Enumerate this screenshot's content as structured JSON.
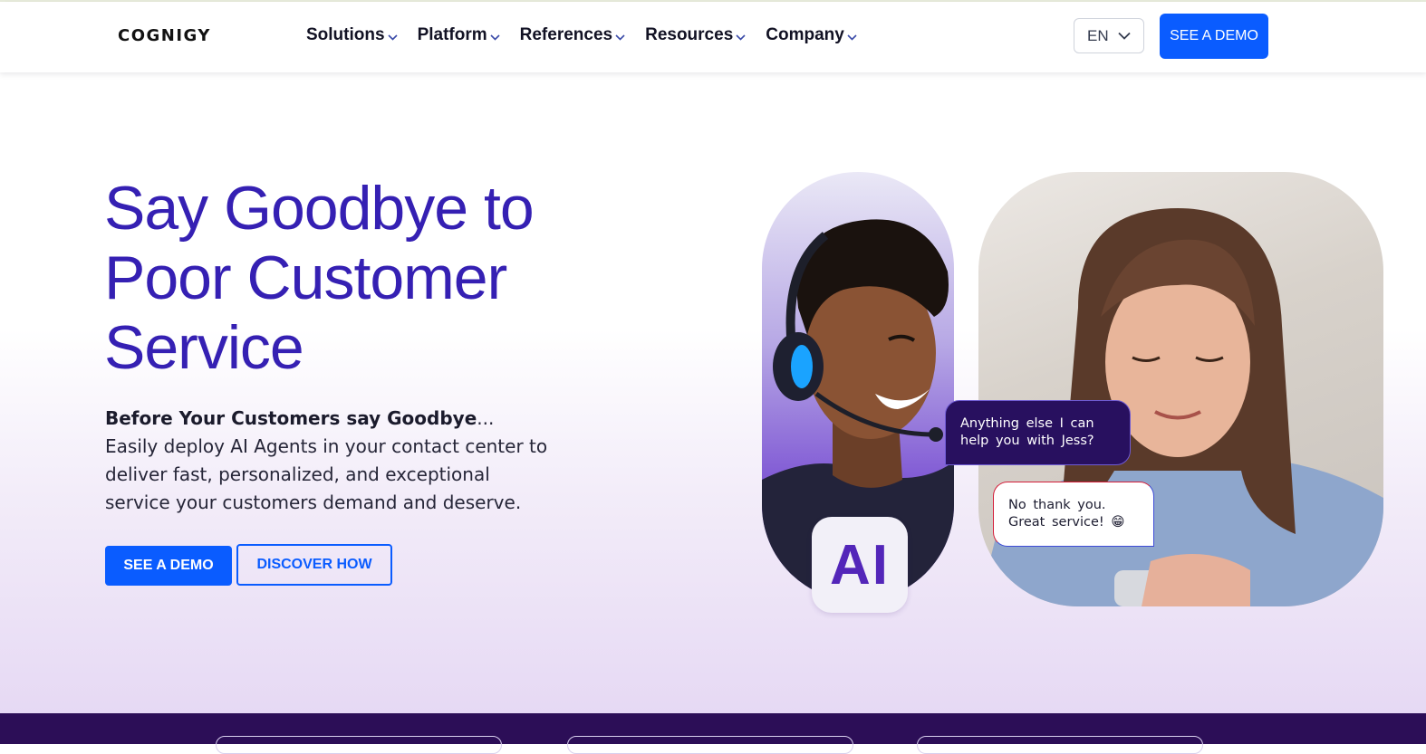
{
  "header": {
    "logo": "COGNIGY",
    "nav": [
      {
        "label": "Solutions"
      },
      {
        "label": "Platform"
      },
      {
        "label": "References"
      },
      {
        "label": "Resources"
      },
      {
        "label": "Company"
      }
    ],
    "language": "EN",
    "demo_label": "SEE A DEMO"
  },
  "hero": {
    "headline": "Say Goodbye to Poor Customer Service",
    "lead_bold": "Before Your Customers say Goodbye",
    "lead_rest": "... Easily deploy AI Agents in your contact center to deliver fast, personalized, and exceptional service your customers demand and deserve.",
    "primary_cta": "SEE A DEMO",
    "secondary_cta": "DISCOVER HOW",
    "ai_badge": "AI",
    "chat": {
      "bot_line1": "Anything else I can",
      "bot_line2": "help you with Jess?",
      "user_line1": "No thank you.",
      "user_line2": "Great service! 😁"
    }
  },
  "colors": {
    "brand_blue": "#0a5cff",
    "headline_purple": "#3520b3",
    "bot_bubble": "#28105f",
    "band": "#2c0e57"
  },
  "icons": {
    "nav_chevron": "chevron-down-icon",
    "lang_chevron": "chevron-down-icon"
  }
}
